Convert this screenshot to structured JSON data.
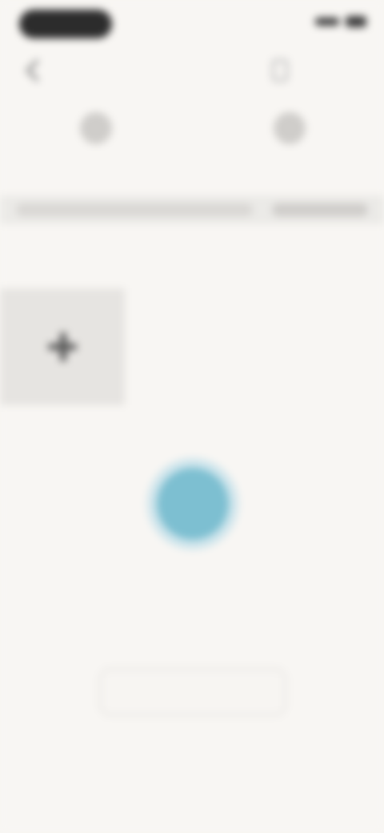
{
  "header": {
    "title": "",
    "subtitle": "",
    "action_label": ""
  },
  "tabs": [
    {
      "label": "",
      "icon": "device-icon"
    },
    {
      "label": "",
      "icon": "device-icon"
    }
  ],
  "segments": [
    {
      "label": ""
    },
    {
      "label": ""
    }
  ],
  "section": {
    "label": ""
  },
  "empty_state": {
    "title": "",
    "description": "",
    "button_label": ""
  },
  "colors": {
    "background": "#f8f6f3",
    "accent": "#7dbfd1"
  }
}
